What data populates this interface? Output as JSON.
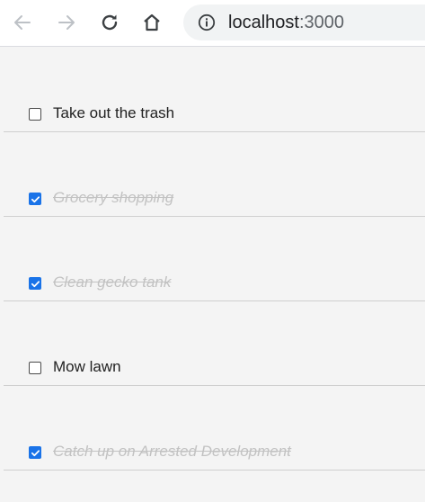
{
  "browser": {
    "url_host": "localhost",
    "url_port": ":3000"
  },
  "todos": [
    {
      "text": "Take out the trash",
      "done": false
    },
    {
      "text": "Grocery shopping",
      "done": true
    },
    {
      "text": "Clean gecko tank",
      "done": true
    },
    {
      "text": "Mow lawn",
      "done": false
    },
    {
      "text": "Catch up on Arrested Development",
      "done": true
    }
  ],
  "colors": {
    "accent": "#1a73e8",
    "done_text": "#c2c2c2"
  },
  "icons": {
    "back": "arrow-left-icon",
    "forward": "arrow-right-icon",
    "reload": "reload-icon",
    "home": "home-icon",
    "info": "info-icon"
  }
}
